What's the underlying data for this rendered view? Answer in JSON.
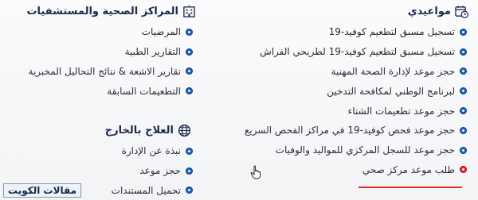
{
  "appointments": {
    "title": "مواعيدي",
    "items": [
      {
        "label": "تسجيل مسبق لتطعيم كوفيد-19"
      },
      {
        "label": "تسجيل مسبق لتطعيم كوفيد-19 لطريحي الفراش"
      },
      {
        "label": "حجز موعد لإدارة الصحة المهنية"
      },
      {
        "label": "لبرنامج الوطني لمكافحة التدخين"
      },
      {
        "label": "حجز موعد تطعيمات الشتاء"
      },
      {
        "label": "حجز موعد فحص كوفيد-19 في مراكز الفحص السريع"
      },
      {
        "label": "حجز موعد للسجل المركزي للمواليد والوفيات"
      },
      {
        "label": "طلب موعد مركز صحي"
      }
    ]
  },
  "health_centers": {
    "title": "المراكز الصحية والمستشفيات",
    "items": [
      {
        "label": "المرضيات"
      },
      {
        "label": "التقارير الطبية"
      },
      {
        "label": "تقارير الاشعة & نتائج التحاليل المخبرية"
      },
      {
        "label": "التطعيمات السابقة"
      }
    ]
  },
  "treatment_abroad": {
    "title": "العلاج بالخارج",
    "items": [
      {
        "label": "نبذة عن الإدارة"
      },
      {
        "label": "حجز موعد"
      },
      {
        "label": "تحميل المستندات"
      }
    ]
  },
  "watermark": {
    "text": "مقالات الكويت"
  },
  "colors": {
    "bullet": "#1e5fb0",
    "bullet_active": "#d72a2a",
    "heading": "#1c2a4d"
  }
}
